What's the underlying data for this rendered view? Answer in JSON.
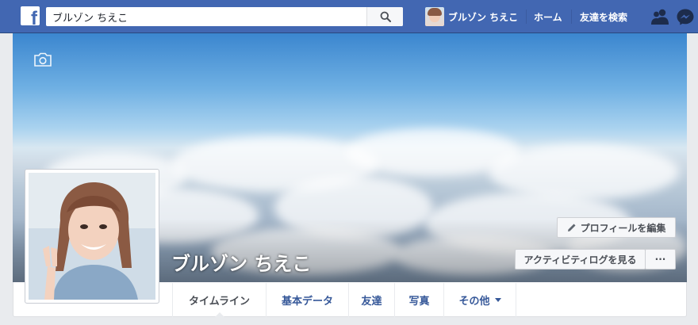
{
  "topbar": {
    "logo_letter": "f",
    "search": {
      "value": "ブルゾン ちえこ",
      "placeholder": ""
    },
    "user_name": "ブルゾン ちえこ",
    "home_label": "ホーム",
    "find_friends_label": "友達を検索",
    "icons": [
      "friend-requests-icon",
      "messenger-icon"
    ],
    "brand_color": "#4267b2"
  },
  "profile": {
    "name": "ブルゾン ちえこ",
    "edit_profile_label": "プロフィールを編集",
    "activity_log_label": "アクティビティログを見る",
    "more_label": "···"
  },
  "tabs": [
    {
      "label": "タイムライン",
      "active": true
    },
    {
      "label": "基本データ",
      "active": false
    },
    {
      "label": "友達",
      "active": false
    },
    {
      "label": "写真",
      "active": false
    },
    {
      "label": "その他",
      "active": false,
      "dropdown": true
    }
  ]
}
